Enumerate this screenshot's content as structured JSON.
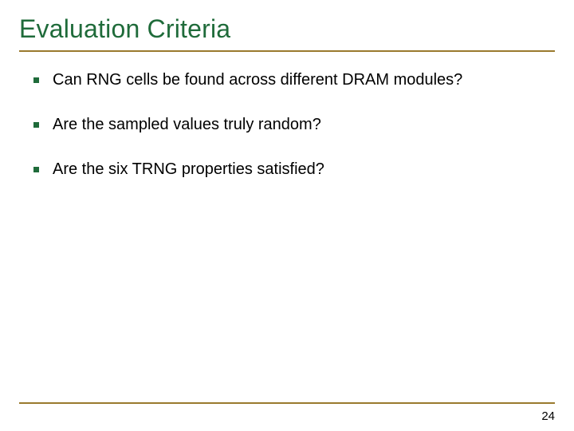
{
  "title": "Evaluation Criteria",
  "bullets": [
    "Can RNG cells be found across different DRAM modules?",
    "Are the sampled values truly random?",
    "Are the six TRNG properties satisfied?"
  ],
  "page_number": "24"
}
